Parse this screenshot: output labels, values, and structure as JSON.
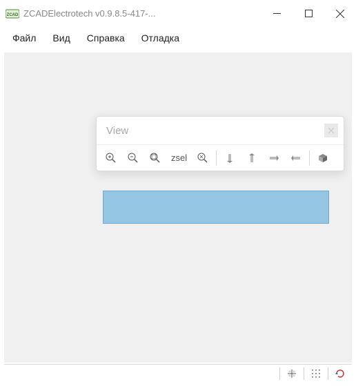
{
  "window": {
    "title": "ZCADElectrotech v0.9.8.5-417-..."
  },
  "menubar": {
    "items": [
      "Файл",
      "Вид",
      "Справка",
      "Отладка"
    ]
  },
  "view_panel": {
    "title": "View",
    "zsel_label": "zsel"
  },
  "icons": {
    "app": "zcad-icon",
    "minimize": "minimize-icon",
    "maximize": "maximize-icon",
    "close": "close-icon",
    "zoom_in": "zoom-in-icon",
    "zoom_out": "zoom-out-icon",
    "zoom_extents": "zoom-extents-icon",
    "zoom_window": "zoom-window-icon",
    "view_top": "view-top-icon",
    "view_bottom": "view-bottom-icon",
    "view_left": "view-left-icon",
    "view_right": "view-right-icon",
    "view_iso": "view-iso-icon",
    "snap_grid": "snap-grid-icon",
    "snap_dots": "snap-dots-icon",
    "refresh": "refresh-icon"
  },
  "colors": {
    "selection": "#94c5e3"
  }
}
